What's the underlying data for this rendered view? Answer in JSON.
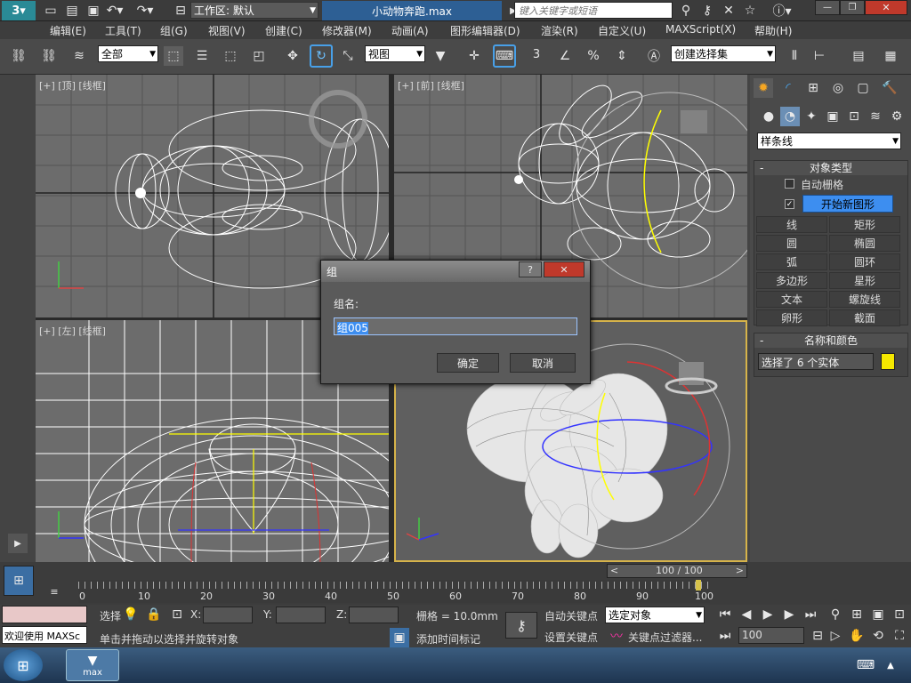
{
  "titlebar": {
    "workspace_label": "工作区: 默认",
    "file_name": "小动物奔跑.max",
    "search_placeholder": "键入关键字或短语"
  },
  "menus": [
    "编辑(E)",
    "工具(T)",
    "组(G)",
    "视图(V)",
    "创建(C)",
    "修改器(M)",
    "动画(A)",
    "图形编辑器(D)",
    "渲染(R)",
    "自定义(U)",
    "MAXScript(X)",
    "帮助(H)"
  ],
  "toolbar": {
    "selection_filter": "全部",
    "ref_coord": "视图",
    "snap_label": "3",
    "named_selection": "创建选择集"
  },
  "viewports": {
    "top_left_label": "[+] [顶] [线框]",
    "top_right_label": "[+] [前] [线框]",
    "bottom_left_label": "[+] [左] [线框]"
  },
  "command_panel": {
    "category_dropdown": "样条线",
    "object_type_header": "对象类型",
    "auto_grid_label": "自动栅格",
    "start_new_shape_label": "开始新图形",
    "object_buttons": [
      "线",
      "矩形",
      "圆",
      "椭圆",
      "弧",
      "圆环",
      "多边形",
      "星形",
      "文本",
      "螺旋线",
      "卵形",
      "截面"
    ],
    "name_color_header": "名称和颜色",
    "name_field": "选择了 6 个实体",
    "swatch_color": "#f5e800"
  },
  "dialog": {
    "title": "组",
    "group_name_label": "组名:",
    "group_name_value": "组005",
    "ok_label": "确定",
    "cancel_label": "取消"
  },
  "timeline": {
    "frame_counter": "100 / 100",
    "ticks": [
      "0",
      "10",
      "20",
      "30",
      "40",
      "50",
      "60",
      "70",
      "80",
      "90",
      "100"
    ]
  },
  "status": {
    "welcome_text": "欢迎使用 MAXSc",
    "select_label": "选择",
    "x_label": "X:",
    "y_label": "Y:",
    "z_label": "Z:",
    "grid_label": "栅格 = 10.0mm",
    "prompt_text": "单击并拖动以选择并旋转对象",
    "add_time_tag": "添加时间标记",
    "auto_key": "自动关键点",
    "selected_object": "选定对象",
    "set_key": "设置关键点",
    "key_filter": "关键点过滤器...",
    "frame_field": "100"
  },
  "taskbar": {
    "app_label": "max"
  }
}
